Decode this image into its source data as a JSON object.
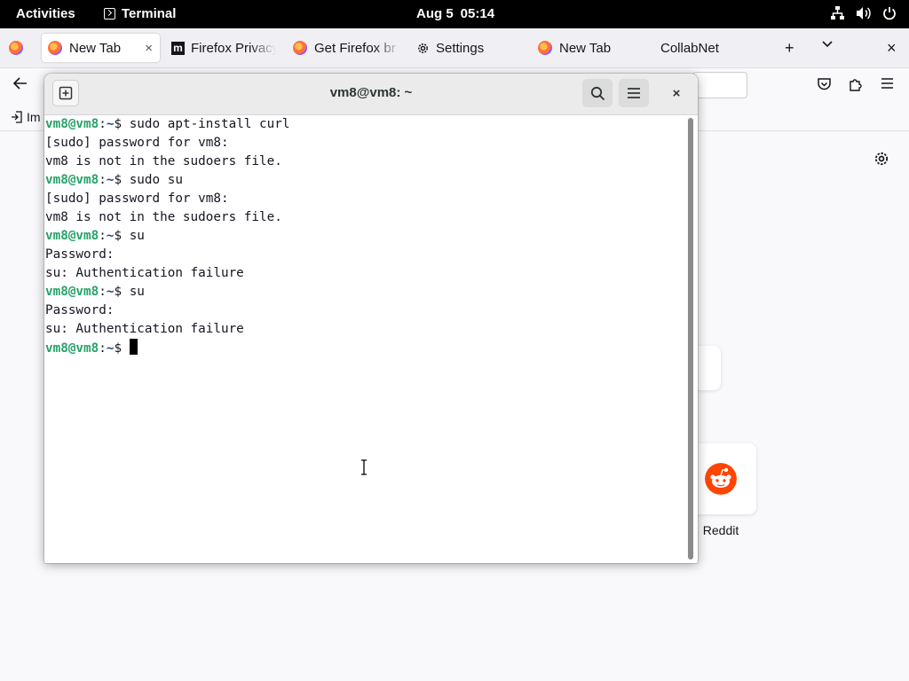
{
  "topbar": {
    "activities": "Activities",
    "app_name": "Terminal",
    "date": "Aug 5",
    "time": "05:14",
    "tray_icons": [
      "network-icon",
      "volume-icon",
      "power-icon"
    ]
  },
  "browser": {
    "tabs": [
      {
        "label": "New Tab",
        "icon": "firefox-icon",
        "active": true
      },
      {
        "label": "Firefox Privacy",
        "icon": "mozilla-icon"
      },
      {
        "label": "Get Firefox br",
        "icon": "firefox-icon"
      },
      {
        "label": "Settings",
        "icon": "gear-icon"
      },
      {
        "label": "New Tab",
        "icon": "firefox-icon"
      },
      {
        "label": "CollabNet",
        "icon": "none"
      }
    ],
    "tab_close": "×",
    "new_tab_button": "+",
    "list_all_tabs": "⌄",
    "window_close": "×",
    "bookmarks_import": "Im",
    "shortcut_label": "Reddit"
  },
  "terminal": {
    "title": "vm8@vm8: ~",
    "close": "×",
    "prompt_user": "vm8@vm8",
    "prompt_path": "~",
    "prompt_symbol": "$ ",
    "lines": [
      {
        "type": "prompt",
        "cmd": "sudo apt-install curl"
      },
      {
        "type": "output",
        "text": "[sudo] password for vm8:"
      },
      {
        "type": "output",
        "text": "vm8 is not in the sudoers file."
      },
      {
        "type": "prompt",
        "cmd": "sudo su"
      },
      {
        "type": "output",
        "text": "[sudo] password for vm8:"
      },
      {
        "type": "output",
        "text": "vm8 is not in the sudoers file."
      },
      {
        "type": "prompt",
        "cmd": "su"
      },
      {
        "type": "output",
        "text": "Password:"
      },
      {
        "type": "output",
        "text": "su: Authentication failure"
      },
      {
        "type": "prompt",
        "cmd": "su"
      },
      {
        "type": "output",
        "text": "Password:"
      },
      {
        "type": "output",
        "text": "su: Authentication failure"
      },
      {
        "type": "prompt",
        "cmd": "",
        "cursor": true
      }
    ]
  },
  "colors": {
    "prompt_user": "#26a269",
    "prompt_path": "#12488b",
    "topbar_bg": "#000000",
    "reddit": "#ff4500"
  }
}
